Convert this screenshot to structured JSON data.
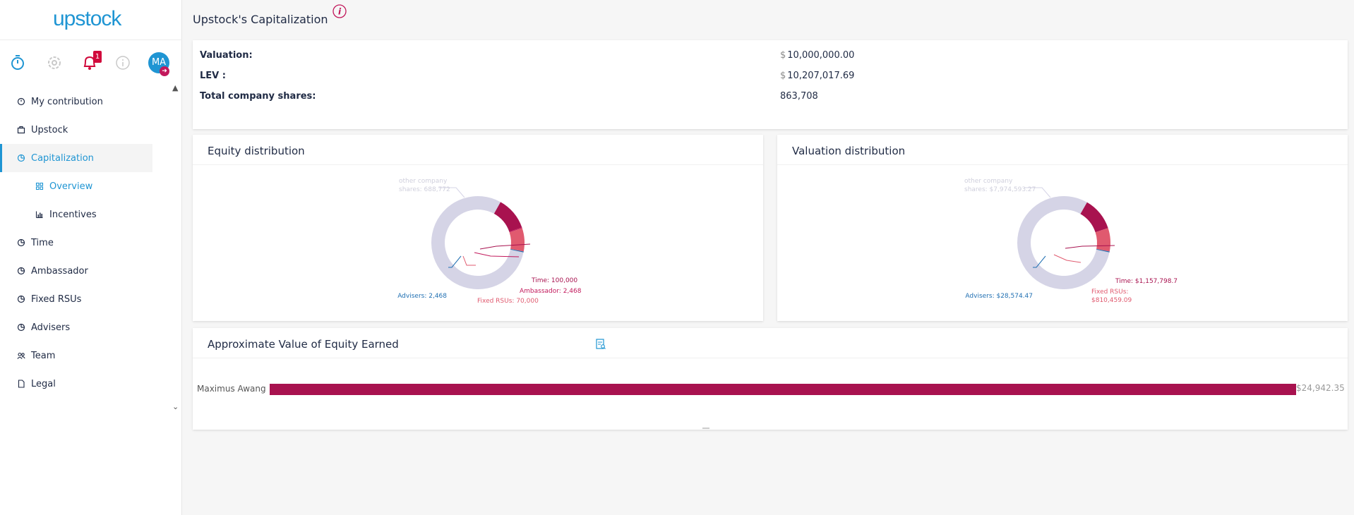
{
  "app": {
    "logo": "upstock"
  },
  "header": {
    "notification_count": "1",
    "avatar_initials": "MA"
  },
  "sidebar": {
    "items": [
      {
        "label": "My contribution"
      },
      {
        "label": "Upstock"
      },
      {
        "label": "Capitalization"
      },
      {
        "label": "Overview"
      },
      {
        "label": "Incentives"
      },
      {
        "label": "Time"
      },
      {
        "label": "Ambassador"
      },
      {
        "label": "Fixed RSUs"
      },
      {
        "label": "Advisers"
      },
      {
        "label": "Team"
      },
      {
        "label": "Legal"
      }
    ]
  },
  "page": {
    "title": "Upstock's Capitalization"
  },
  "summary": {
    "rows": [
      {
        "label": "Valuation:",
        "currency": "$",
        "value": "10,000,000.00"
      },
      {
        "label": "LEV :",
        "currency": "$",
        "value": "10,207,017.69"
      },
      {
        "label": "Total company shares:",
        "currency": "",
        "value": "863,708"
      }
    ]
  },
  "equity": {
    "title": "Equity distribution",
    "labels": {
      "other": [
        "other company",
        "shares: 688,772"
      ],
      "time": "Time: 100,000",
      "ambassador": "Ambassador: 2,468",
      "fixed": "Fixed RSUs: 70,000",
      "advisers": "Advisers: 2,468"
    }
  },
  "valuation": {
    "title": "Valuation distribution",
    "labels": {
      "other": [
        "other company",
        "shares: $7,974,593.27"
      ],
      "time": "Time: $1,157,798.7",
      "fixed": [
        "Fixed RSUs:",
        "$810,459.09"
      ],
      "advisers": "Advisers: $28,574.47"
    }
  },
  "approx": {
    "title": "Approximate Value of Equity Earned",
    "rows": [
      {
        "name": "Maximus Awang",
        "value": "$24,942.35",
        "fraction": 1.0
      }
    ]
  },
  "chart_data": [
    {
      "type": "pie",
      "title": "Equity distribution",
      "categories": [
        "other company shares",
        "Time",
        "Ambassador",
        "Fixed RSUs",
        "Advisers"
      ],
      "values": [
        688772,
        100000,
        2468,
        70000,
        2468
      ],
      "colors": [
        "#d5d4e6",
        "#a8124f",
        "#c2185b",
        "#e05a6f",
        "#1f6fb2"
      ]
    },
    {
      "type": "pie",
      "title": "Valuation distribution",
      "categories": [
        "other company shares",
        "Time",
        "Fixed RSUs",
        "Advisers"
      ],
      "values": [
        7974593.27,
        1157798.7,
        810459.09,
        28574.47
      ],
      "colors": [
        "#d5d4e6",
        "#a8124f",
        "#e05a6f",
        "#1f6fb2"
      ]
    },
    {
      "type": "bar",
      "title": "Approximate Value of Equity Earned",
      "categories": [
        "Maximus Awang"
      ],
      "values": [
        24942.35
      ]
    }
  ],
  "colors": {
    "accent": "#1f95d3",
    "magenta": "#a8124f",
    "pink": "#e05a6f",
    "other": "#d5d4e6"
  }
}
